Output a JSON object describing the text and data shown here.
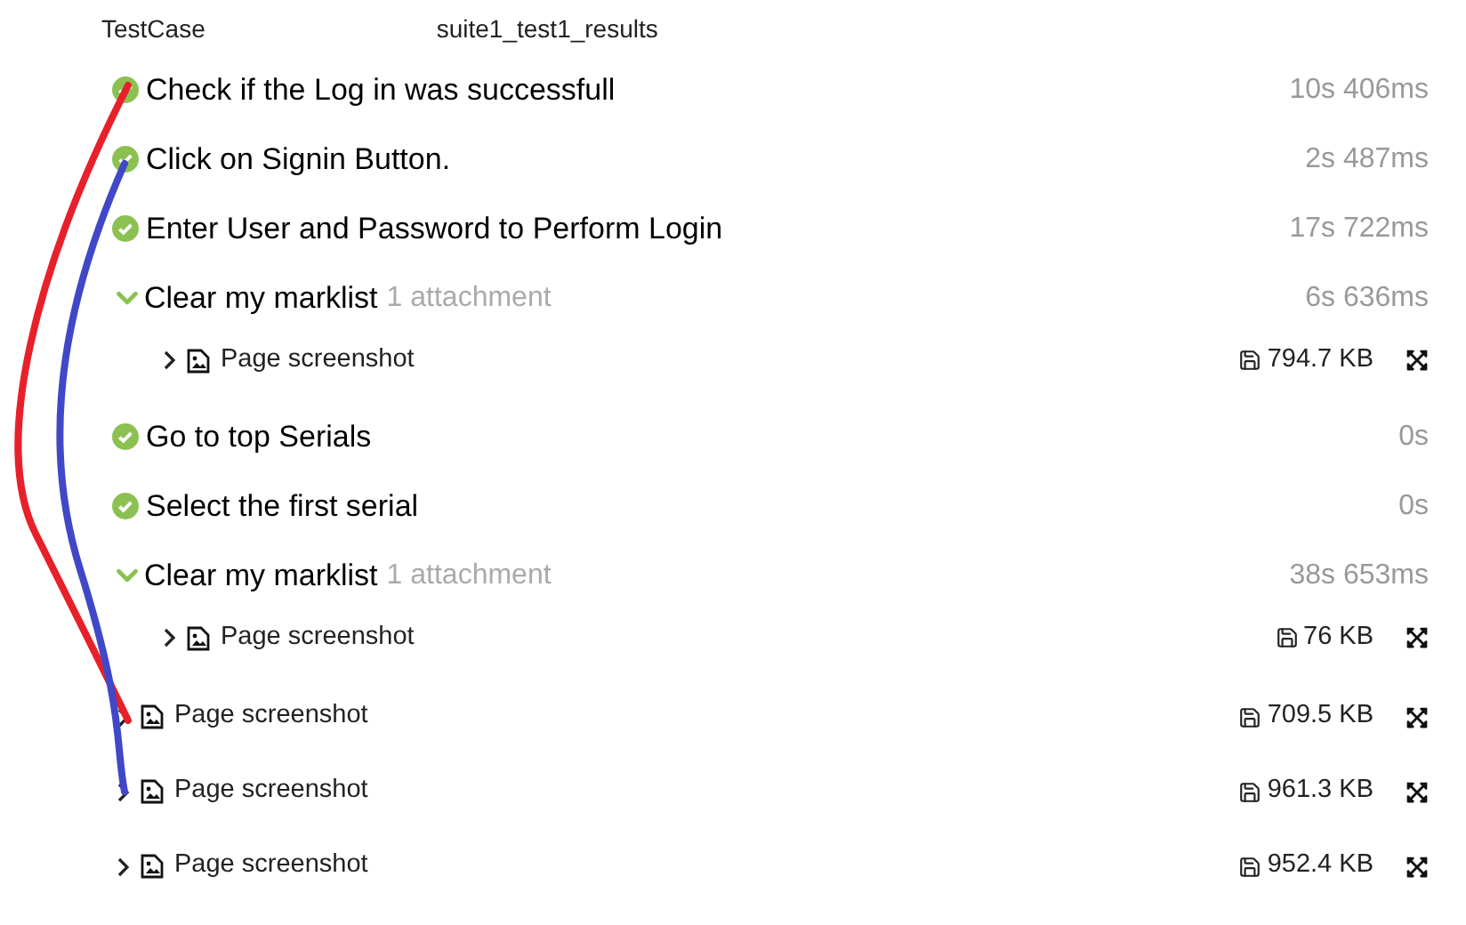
{
  "header": {
    "column_1": "TestCase",
    "column_2": "suite1_test1_results"
  },
  "steps": [
    {
      "kind": "step",
      "name": "Check if the Log in was successfull",
      "duration": "10s 406ms"
    },
    {
      "kind": "step",
      "name": "Click on Signin Button.",
      "duration": "2s 487ms"
    },
    {
      "kind": "step",
      "name": "Enter User and Password to Perform Login",
      "duration": "17s 722ms"
    },
    {
      "kind": "group",
      "expanded": true,
      "name": "Clear my marklist",
      "attachments": "1 attachment",
      "duration": "6s 636ms",
      "children": [
        {
          "kind": "attachment",
          "expanded": false,
          "name": "Page screenshot",
          "size": "794.7 KB"
        }
      ]
    },
    {
      "kind": "step",
      "name": "Go to top Serials",
      "duration": "0s"
    },
    {
      "kind": "step",
      "name": "Select the first serial",
      "duration": "0s"
    },
    {
      "kind": "group",
      "expanded": true,
      "name": "Clear my marklist",
      "attachments": "1 attachment",
      "duration": "38s 653ms",
      "children": [
        {
          "kind": "attachment",
          "expanded": false,
          "name": "Page screenshot",
          "size": "76 KB"
        }
      ]
    },
    {
      "kind": "attachment",
      "expanded": false,
      "name": "Page screenshot",
      "size": "709.5 KB"
    },
    {
      "kind": "attachment",
      "expanded": false,
      "name": "Page screenshot",
      "size": "961.3 KB"
    },
    {
      "kind": "attachment",
      "expanded": false,
      "name": "Page screenshot",
      "size": "952.4 KB"
    }
  ],
  "annotations": [
    {
      "kind": "curve",
      "color": "#e8202a"
    },
    {
      "kind": "curve",
      "color": "#4048c8"
    }
  ]
}
